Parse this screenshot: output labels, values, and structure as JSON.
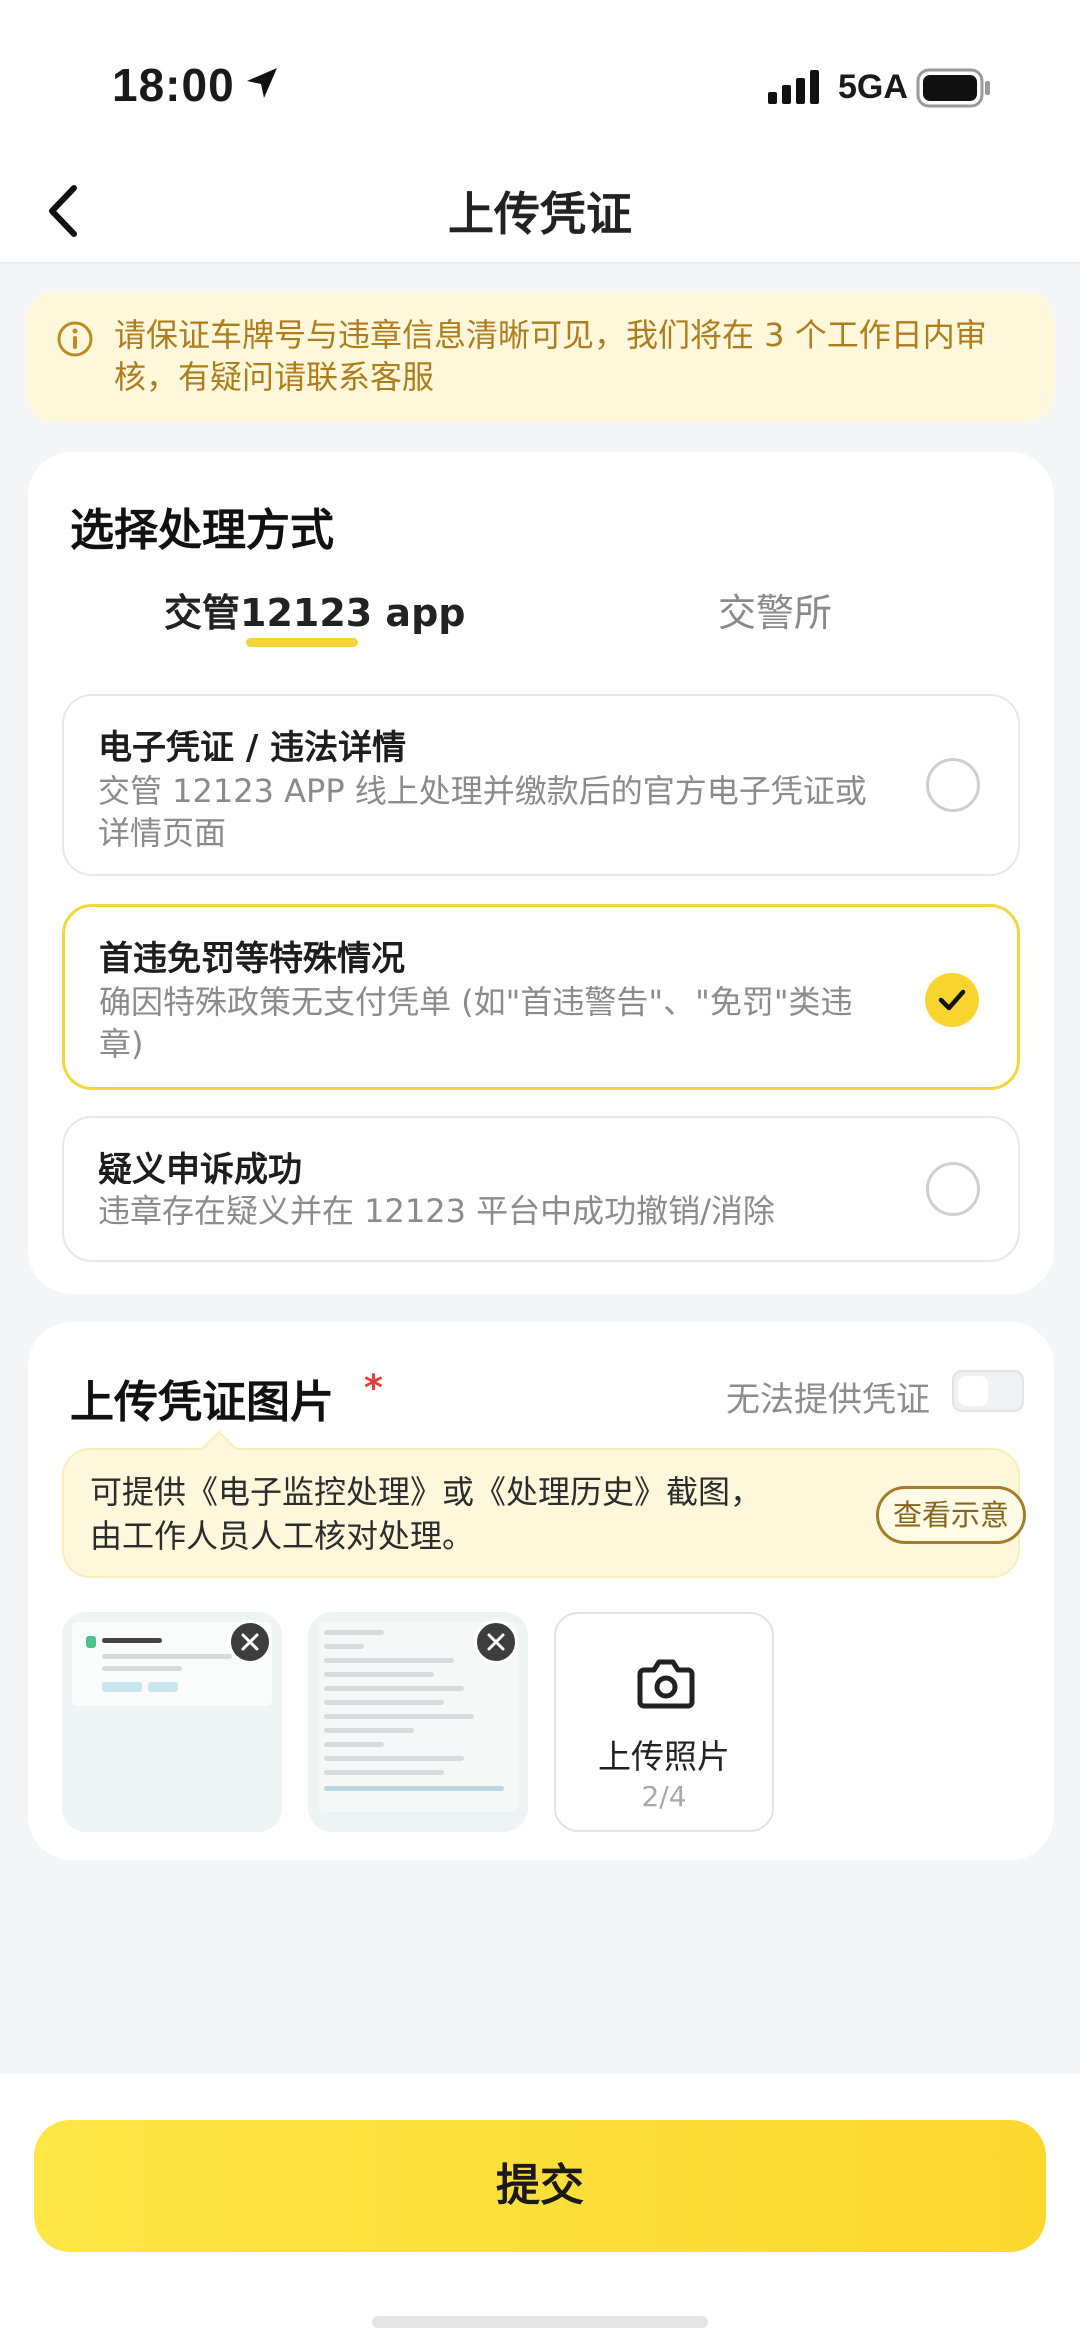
{
  "status_bar": {
    "time": "18:00",
    "network": "5GA",
    "icons": [
      "location-arrow-icon",
      "signal-icon",
      "battery-icon"
    ]
  },
  "nav": {
    "title": "上传凭证",
    "back_icon": "chevron-left-icon"
  },
  "notice": {
    "icon": "info-circle-icon",
    "text": "请保证车牌号与违章信息清晰可见，我们将在 3 个工作日内审核，有疑问请联系客服"
  },
  "method": {
    "title": "选择处理方式",
    "tabs": [
      {
        "label": "交管12123 app",
        "active": true
      },
      {
        "label": "交警所",
        "active": false
      }
    ],
    "options": [
      {
        "title": "电子凭证 / 违法详情",
        "desc": "交管 12123 APP 线上处理并缴款后的官方电子凭证或详情页面",
        "selected": false
      },
      {
        "title": "首违免罚等特殊情况",
        "desc": "确因特殊政策无支付凭单 (如\"首违警告\"、\"免罚\"类违章)",
        "selected": true
      },
      {
        "title": "疑义申诉成功",
        "desc": "违章存在疑义并在 12123 平台中成功撤销/消除",
        "selected": false
      }
    ]
  },
  "upload": {
    "title": "上传凭证图片",
    "required_mark": "*",
    "no_voucher_label": "无法提供凭证",
    "no_voucher_enabled": false,
    "hint": "可提供《电子监控处理》或《处理历史》截图，由工作人员人工核对处理。",
    "example_button": "查看示意",
    "thumbnails": [
      {
        "name": "uploaded-screenshot-1"
      },
      {
        "name": "uploaded-screenshot-2"
      }
    ],
    "add_label": "上传照片",
    "count": "2/4"
  },
  "submit_label": "提交",
  "colors": {
    "accent": "#f7d52e",
    "notice_text": "#b07d1c",
    "notice_bg": "#fdf8dc",
    "required": "#e63b3b"
  }
}
